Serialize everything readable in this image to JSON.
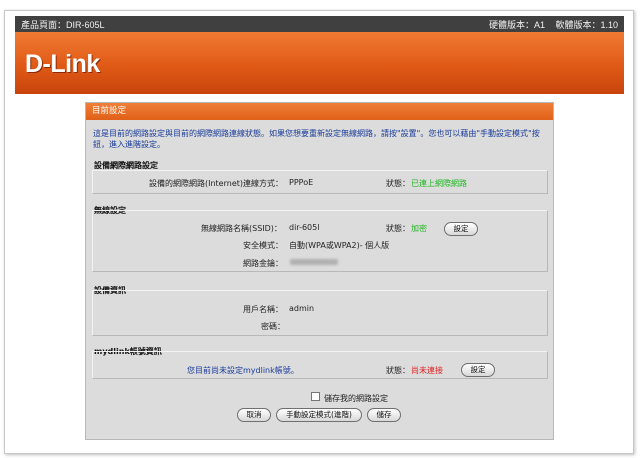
{
  "topbar": {
    "product": "產品頁面：DIR-605L",
    "hw": "硬體版本：A1",
    "fw": "軟體版本：1.10"
  },
  "logo": "D-Link",
  "panel": {
    "title": "目前設定",
    "description": "這是目前的網路設定與目前的網際網路連線狀態。如果您想要重新設定無線網路，請按\"設置\"。您也可以藉由\"手動設定模式\"按鈕，進入進階設定。"
  },
  "wan": {
    "section": "設備網際網路設定",
    "conn_label": "設備的網際網路(Internet)連線方式：",
    "conn_value": "PPPoE",
    "status_label": "狀態：",
    "status_value": "已連上網際網路"
  },
  "wireless": {
    "section": "無線設定",
    "ssid_label": "無線網路名稱(SSID)：",
    "ssid_value": "dir-605l",
    "status_label": "狀態：",
    "status_value": "加密",
    "setup_button": "設定",
    "security_label": "安全模式：",
    "security_value": "自動(WPA或WPA2)- 個人版",
    "key_label": "網路金鑰："
  },
  "device": {
    "section": "設備資訊",
    "user_label": "用戶名稱：",
    "user_value": "admin",
    "pass_label": "密碼："
  },
  "mydlink": {
    "section": "mydlink帳號資訊",
    "message": "您目前尚未設定mydlink帳號。",
    "status_label": "狀態：",
    "status_value": "尚未連接",
    "setup_button": "設定"
  },
  "footer": {
    "save_network_label": "儲存我的網路設定",
    "cancel_button": "取消",
    "manual_button": "手動設定模式(進階)",
    "save_button": "儲存"
  },
  "colors": {
    "orange": "#e05a16",
    "status_ok": "#1db81d",
    "status_bad": "#e01f1f",
    "info_text": "#1a3c9a"
  }
}
